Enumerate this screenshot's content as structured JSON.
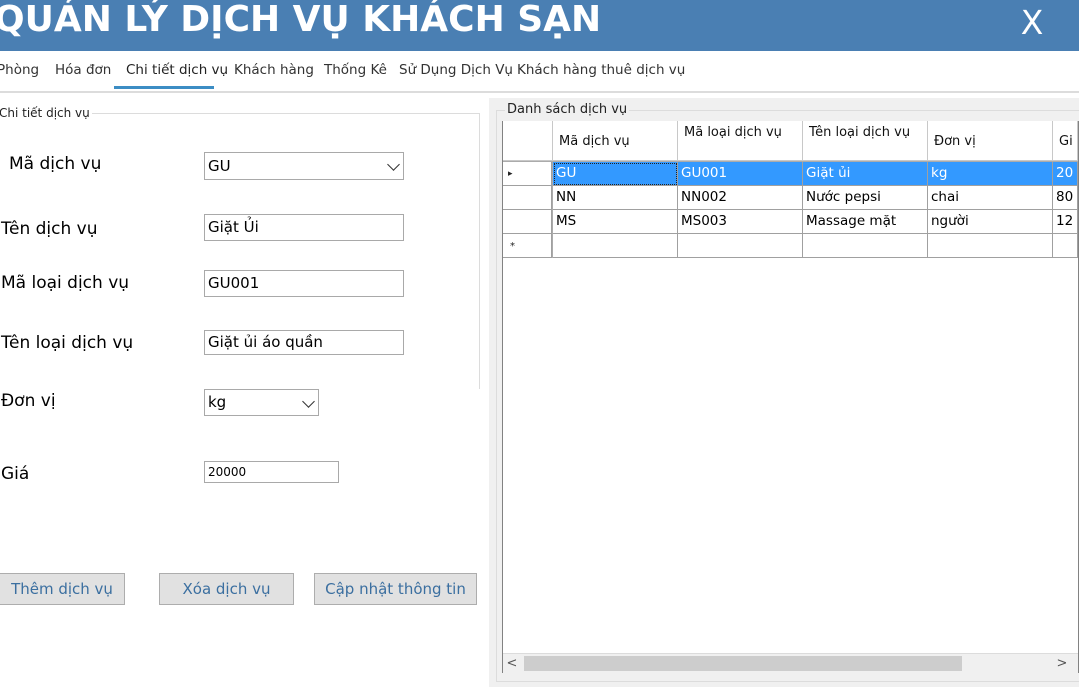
{
  "app": {
    "title": "QUẢN LÝ DỊCH VỤ KHÁCH SẠN",
    "close_label": "X"
  },
  "tabs": [
    {
      "label": "Phòng"
    },
    {
      "label": "Hóa đơn"
    },
    {
      "label": "Chi tiết dịch vụ"
    },
    {
      "label": "Khách hàng"
    },
    {
      "label": "Thống Kê"
    },
    {
      "label": "Sử Dụng Dịch Vụ"
    },
    {
      "label": "Khách hàng thuê dịch vụ"
    }
  ],
  "active_tab": "Chi tiết dịch vụ",
  "form": {
    "group_label": "Chi tiết dịch vụ",
    "ma_dich_vu": {
      "label": "Mã dịch vụ",
      "value": "GU"
    },
    "ten_dich_vu": {
      "label": "Tên dịch vụ",
      "value": "Giặt Ủi"
    },
    "ma_loai": {
      "label": "Mã loại dịch vụ",
      "value": "GU001"
    },
    "ten_loai": {
      "label": "Tên loại dịch vụ",
      "value": "Giặt ủi áo quần"
    },
    "don_vi": {
      "label": "Đơn vị",
      "value": "kg"
    },
    "gia": {
      "label": "Giá",
      "value": "20000"
    }
  },
  "buttons": {
    "add": "Thêm dịch vụ",
    "delete": "Xóa dịch vụ",
    "update": "Cập nhật thông tin"
  },
  "grid": {
    "group_label": "Danh sách dịch vụ",
    "columns": [
      "Mã dịch vụ",
      "Mã loại dịch vụ",
      "Tên loại dịch vụ",
      "Đơn vị",
      "Gi"
    ],
    "rows": [
      [
        "GU",
        "GU001",
        "Giặt ủi",
        "kg",
        "20"
      ],
      [
        "NN",
        "NN002",
        "Nước pepsi",
        "chai",
        "80"
      ],
      [
        "MS",
        "MS003",
        "Massage mặt",
        "người",
        "12"
      ]
    ],
    "row_markers": {
      "current": "▸",
      "new": "*"
    },
    "scroll": {
      "left": "<",
      "right": ">"
    }
  },
  "colors": {
    "titlebar": "#4a7fb3",
    "selection": "#3399ff",
    "button_text": "#3b6fa0"
  }
}
